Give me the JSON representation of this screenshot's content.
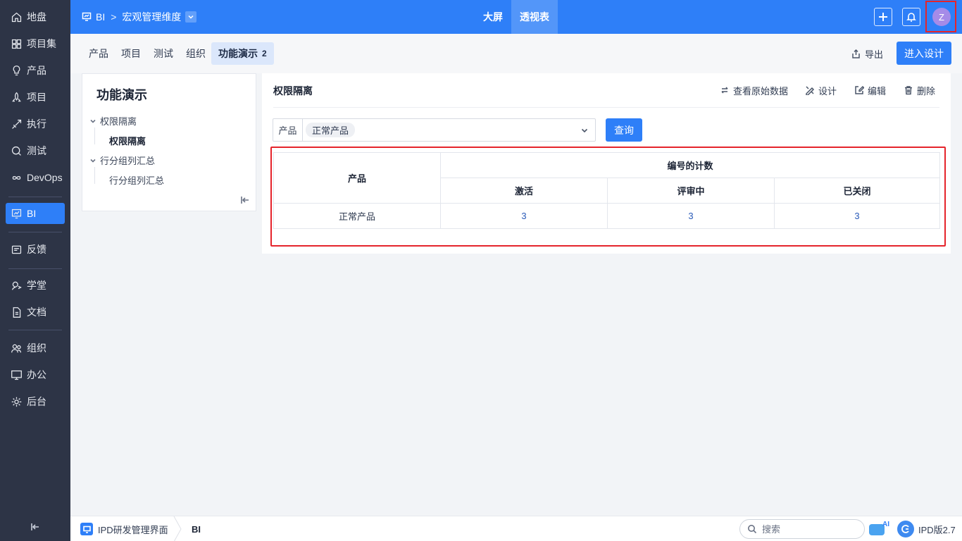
{
  "sidebar": {
    "items": [
      {
        "label": "地盘",
        "icon": "home-icon"
      },
      {
        "label": "项目集",
        "icon": "grid-icon"
      },
      {
        "label": "产品",
        "icon": "bulb-icon"
      },
      {
        "label": "项目",
        "icon": "rocket-icon"
      },
      {
        "label": "执行",
        "icon": "run-icon"
      },
      {
        "label": "测试",
        "icon": "test-icon"
      },
      {
        "label": "DevOps",
        "icon": "infinity-icon"
      },
      {
        "label": "BI",
        "icon": "chart-icon"
      },
      {
        "label": "反馈",
        "icon": "feedback-icon"
      },
      {
        "label": "学堂",
        "icon": "school-icon"
      },
      {
        "label": "文档",
        "icon": "document-icon"
      },
      {
        "label": "组织",
        "icon": "users-icon"
      },
      {
        "label": "办公",
        "icon": "office-icon"
      },
      {
        "label": "后台",
        "icon": "settings-icon"
      }
    ],
    "active": "BI"
  },
  "header": {
    "module": "BI",
    "dimension": "宏观管理维度",
    "tabs": [
      "大屏",
      "透视表"
    ],
    "active_tab": "透视表",
    "avatar_letter": "Z"
  },
  "subtabs": {
    "items": [
      "产品",
      "项目",
      "测试",
      "组织",
      "功能演示"
    ],
    "active": "功能演示",
    "active_count": "2",
    "export_label": "导出",
    "design_label": "进入设计"
  },
  "tree": {
    "title": "功能演示",
    "groups": [
      {
        "label": "权限隔离",
        "children": [
          "权限隔离"
        ]
      },
      {
        "label": "行分组列汇总",
        "children": [
          "行分组列汇总"
        ]
      }
    ]
  },
  "main": {
    "title": "权限隔离",
    "actions": {
      "raw": "查看原始数据",
      "design": "设计",
      "edit": "编辑",
      "delete": "删除"
    },
    "filter": {
      "label": "产品",
      "value": "正常产品",
      "query": "查询"
    },
    "table": {
      "row_header": "产品",
      "group_header": "编号的计数",
      "columns": [
        "激活",
        "评审中",
        "已关闭"
      ],
      "rows": [
        {
          "name": "正常产品",
          "values": [
            "3",
            "3",
            "3"
          ]
        }
      ]
    }
  },
  "footer": {
    "app_name": "IPD研发管理界面",
    "crumb": "BI",
    "search_placeholder": "搜索",
    "ai_label": "AI",
    "version": "IPD版2.7"
  },
  "colors": {
    "primary": "#2e7ff8",
    "sidebar_bg": "#2d3446",
    "highlight": "#e5242b"
  }
}
